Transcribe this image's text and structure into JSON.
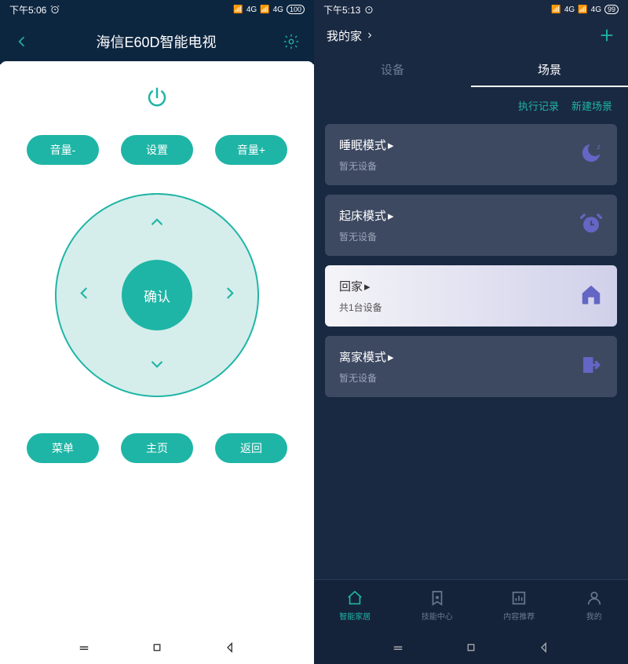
{
  "left": {
    "status": {
      "time": "下午5:06",
      "net": "4G",
      "battery": "100"
    },
    "title": "海信E60D智能电视",
    "buttons": {
      "vol_down": "音量-",
      "settings": "设置",
      "vol_up": "音量+",
      "menu": "菜单",
      "home": "主页",
      "back": "返回",
      "ok": "确认"
    }
  },
  "right": {
    "status": {
      "time": "下午5:13",
      "net": "4G",
      "battery": "99"
    },
    "header": {
      "home_label": "我的家"
    },
    "tabs": {
      "devices": "设备",
      "scenes": "场景"
    },
    "actions": {
      "log": "执行记录",
      "new": "新建场景"
    },
    "scenes": [
      {
        "title": "睡眠模式",
        "sub": "暂无设备",
        "icon": "moon",
        "highlight": false
      },
      {
        "title": "起床模式",
        "sub": "暂无设备",
        "icon": "alarm",
        "highlight": false
      },
      {
        "title": "回家",
        "sub": "共1台设备",
        "icon": "home",
        "highlight": true
      },
      {
        "title": "离家模式",
        "sub": "暂无设备",
        "icon": "exit",
        "highlight": false
      }
    ],
    "bottom_nav": {
      "smart_home": "智能家居",
      "skills": "技能中心",
      "content": "内容推荐",
      "mine": "我的"
    }
  }
}
